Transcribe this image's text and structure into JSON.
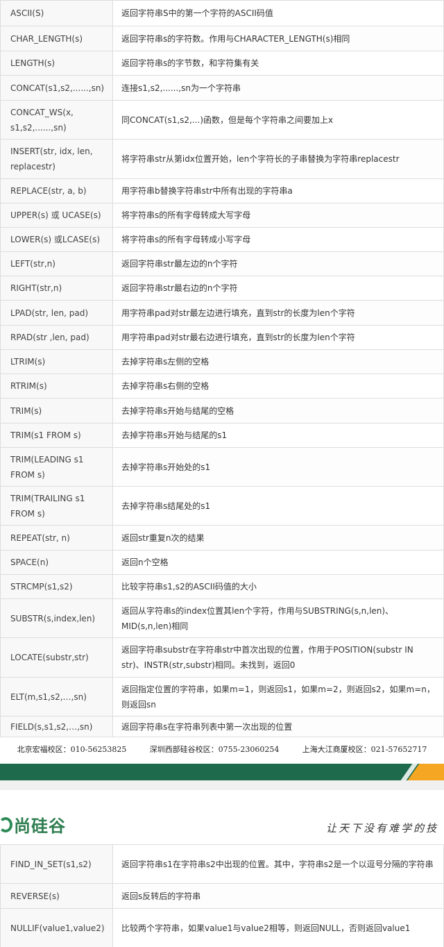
{
  "rows": [
    {
      "fn": "ASCII(S)",
      "desc": "返回字符串S中的第一个字符的ASCII码值"
    },
    {
      "fn": "CHAR_LENGTH(s)",
      "desc": "返回字符串s的字符数。作用与CHARACTER_LENGTH(s)相同"
    },
    {
      "fn": "LENGTH(s)",
      "desc": "返回字符串s的字节数，和字符集有关"
    },
    {
      "fn": "CONCAT(s1,s2,......,sn)",
      "desc": "连接s1,s2,......,sn为一个字符串"
    },
    {
      "fn": "CONCAT_WS(x, s1,s2,......,sn)",
      "desc": "同CONCAT(s1,s2,...)函数，但是每个字符串之间要加上x"
    },
    {
      "fn": "INSERT(str, idx, len, replacestr)",
      "desc": "将字符串str从第idx位置开始，len个字符长的子串替换为字符串replacestr"
    },
    {
      "fn": "REPLACE(str, a, b)",
      "desc": "用字符串b替换字符串str中所有出现的字符串a"
    },
    {
      "fn": "UPPER(s) 或 UCASE(s)",
      "desc": "将字符串s的所有字母转成大写字母"
    },
    {
      "fn": "LOWER(s) 或LCASE(s)",
      "desc": "将字符串s的所有字母转成小写字母"
    },
    {
      "fn": "LEFT(str,n)",
      "desc": "返回字符串str最左边的n个字符"
    },
    {
      "fn": "RIGHT(str,n)",
      "desc": "返回字符串str最右边的n个字符"
    },
    {
      "fn": "LPAD(str, len, pad)",
      "desc": "用字符串pad对str最左边进行填充，直到str的长度为len个字符"
    },
    {
      "fn": "RPAD(str ,len, pad)",
      "desc": "用字符串pad对str最右边进行填充，直到str的长度为len个字符"
    },
    {
      "fn": "LTRIM(s)",
      "desc": "去掉字符串s左侧的空格"
    },
    {
      "fn": "RTRIM(s)",
      "desc": "去掉字符串s右侧的空格"
    },
    {
      "fn": "TRIM(s)",
      "desc": "去掉字符串s开始与结尾的空格"
    },
    {
      "fn": "TRIM(s1 FROM s)",
      "desc": "去掉字符串s开始与结尾的s1"
    },
    {
      "fn": "TRIM(LEADING s1 FROM s)",
      "desc": "去掉字符串s开始处的s1"
    },
    {
      "fn": "TRIM(TRAILING s1 FROM s)",
      "desc": "去掉字符串s结尾处的s1"
    },
    {
      "fn": "REPEAT(str, n)",
      "desc": "返回str重复n次的结果"
    },
    {
      "fn": "SPACE(n)",
      "desc": "返回n个空格"
    },
    {
      "fn": "STRCMP(s1,s2)",
      "desc": "比较字符串s1,s2的ASCII码值的大小"
    },
    {
      "fn": "SUBSTR(s,index,len)",
      "desc": "返回从字符串s的index位置其len个字符，作用与SUBSTRING(s,n,len)、MID(s,n,len)相同"
    },
    {
      "fn": "LOCATE(substr,str)",
      "desc": "返回字符串substr在字符串str中首次出现的位置，作用于POSITION(substr IN str)、INSTR(str,substr)相同。未找到，返回0"
    },
    {
      "fn": "ELT(m,s1,s2,…,sn)",
      "desc": "返回指定位置的字符串，如果m=1，则返回s1，如果m=2，则返回s2，如果m=n，则返回sn"
    },
    {
      "fn": "FIELD(s,s1,s2,…,sn)",
      "desc": "返回字符串s在字符串列表中第一次出现的位置"
    }
  ],
  "footer": {
    "beijing": "北京宏福校区：010-56253825",
    "shenzhen": "深圳西部硅谷校区：0755-23060254",
    "shanghai": "上海大江商厦校区：021-57652717"
  },
  "brand": {
    "logo_text": "尚硅谷",
    "slogan": "让天下没有难学的技",
    "band_color": "#1d6b4c",
    "accent_color": "#f5a623"
  },
  "rows_cont": [
    {
      "fn": "FIND_IN_SET(s1,s2)",
      "desc": "返回字符串s1在字符串s2中出现的位置。其中，字符串s2是一个以逗号分隔的字符串"
    },
    {
      "fn": "REVERSE(s)",
      "desc": "返回s反转后的字符串"
    },
    {
      "fn": "NULLIF(value1,value2)",
      "desc": "比较两个字符串，如果value1与value2相等，则返回NULL，否则返回value1"
    }
  ]
}
